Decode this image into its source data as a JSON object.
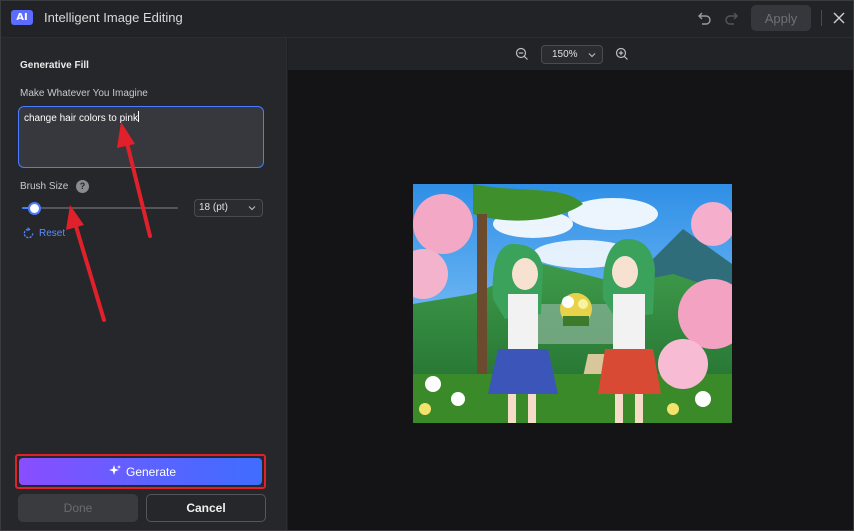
{
  "titlebar": {
    "logo": "AI",
    "title": "Intelligent Image Editing",
    "apply_label": "Apply",
    "icons": [
      "undo-icon",
      "redo-icon",
      "close-icon"
    ]
  },
  "panel": {
    "section_title": "Generative Fill",
    "prompt_label": "Make Whatever You Imagine",
    "prompt_value": "change hair colors to pink",
    "brush_label": "Brush Size",
    "brush_size_value": "18 (pt)",
    "brush_slider_level": 0.08,
    "reset_label": "Reset",
    "generate_label": "Generate",
    "done_label": "Done",
    "cancel_label": "Cancel"
  },
  "canvas": {
    "zoom_level": "150%"
  },
  "colors": {
    "accent": "#4a7cff",
    "highlight_box": "#e0202a",
    "annotation_arrow": "#e0202a"
  }
}
